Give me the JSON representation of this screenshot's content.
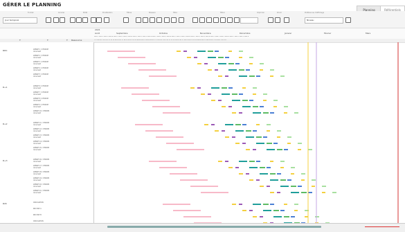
{
  "app_title": "GÉRER LE PLANNING",
  "top_tabs": {
    "planning": "Planning",
    "referentiel": "Référentiels"
  },
  "toolbar": {
    "groups": [
      "Format",
      "Annuler",
      "Edité",
      "Pondération",
      "Filtres",
      "Niveaux",
      "Filtre",
      "Filtrer",
      "Imprimer",
      "Zoom",
      "Préférences d'affichage"
    ],
    "period_select": "Jour temporel",
    "level_select": "Niveau"
  },
  "header": {
    "year": "2021",
    "months": [
      "Août",
      "Septembre",
      "Octobre",
      "Novembre",
      "Décembre",
      "Janvier",
      "Février",
      "Mars"
    ],
    "weeks_row": "Sem 1 Sem 2 Sem 3 Sem 4 Sem 1 Sem 2 Sem 3 Sem 4 Sem 1 Sem 2 Sem 3 Sem 4 Sem 1 Sem 2 Sem 3 Sem 4 Sem 1 Sem 2 Sem 3 Sem 4 Sem 1 Sem 2 Sem 3 Sem 4 Sem 1 Sem 2 Sem 3 Sem 4 Sem 1 Sem 2 Sem 3 Sem 4",
    "days_row": "1 2 3 4 5 6 7 8 9 10 11 12 13 14 15 16 17 18 19 20 21 22 23 24 25 26 27 28 29 30 31 1 2 3 4 5 6 7 8 9 10 11 12 13 14 15 16 17 18 19 20 21 22 23 24 25 26 27 28 29 30 1 2 3 4 5 6 7 8 9 10",
    "col_headers": [
      "T",
      "T",
      "T",
      "Ressource"
    ]
  },
  "sections": [
    {
      "label": "RDC",
      "items": [
        "APPART 1 / CTRXOM document",
        "APPART 2 / CTRXOM document",
        "APPART 3 / CTRXOM document",
        "APPART 4 / CTRXOM document",
        "APPART 5 / CTRXOM document"
      ]
    },
    {
      "label": "R+1",
      "items": [
        "APPART 6 / CTRXOM document",
        "APPART 7 / CTRXOM document",
        "APPART 8 / CTRXOM document",
        "APPART 9 / CTRXOM document",
        "APPART 10 / CTRXOM document"
      ]
    },
    {
      "label": "R+2",
      "items": [
        "APPART 11 / CTRXOM document",
        "APPART 12 / CTRXOM document",
        "APPART 13 / CTRXOM document",
        "APPART 14 / CTRXOM document",
        "APPART 15 / CTRXOM document"
      ]
    },
    {
      "label": "R+3",
      "items": [
        "APPART 16 / CTRXOM document",
        "APPART 17 / CTRXOM document",
        "APPART 18 / CTRXOM document",
        "APPART 19 / CTRXOM document",
        "APPART 20 / CTRXOM document",
        "APPART 21 / CTRXOM document"
      ]
    },
    {
      "label": "R2C",
      "items": [
        "CIRCULATION",
        "RDC BAT A",
        "RDC BAT B",
        "CIRCULATION"
      ]
    }
  ],
  "colors": {
    "pink": "#f7b9c8",
    "yellow": "#f4d03f",
    "purple": "#9b59b6",
    "teal": "#1f9e9a",
    "green": "#5dbb63",
    "blue": "#4a7fd4",
    "gray": "#999999",
    "red": "#d33333",
    "lavender": "#c6a7e6",
    "lightgreen": "#a8e0a0"
  }
}
